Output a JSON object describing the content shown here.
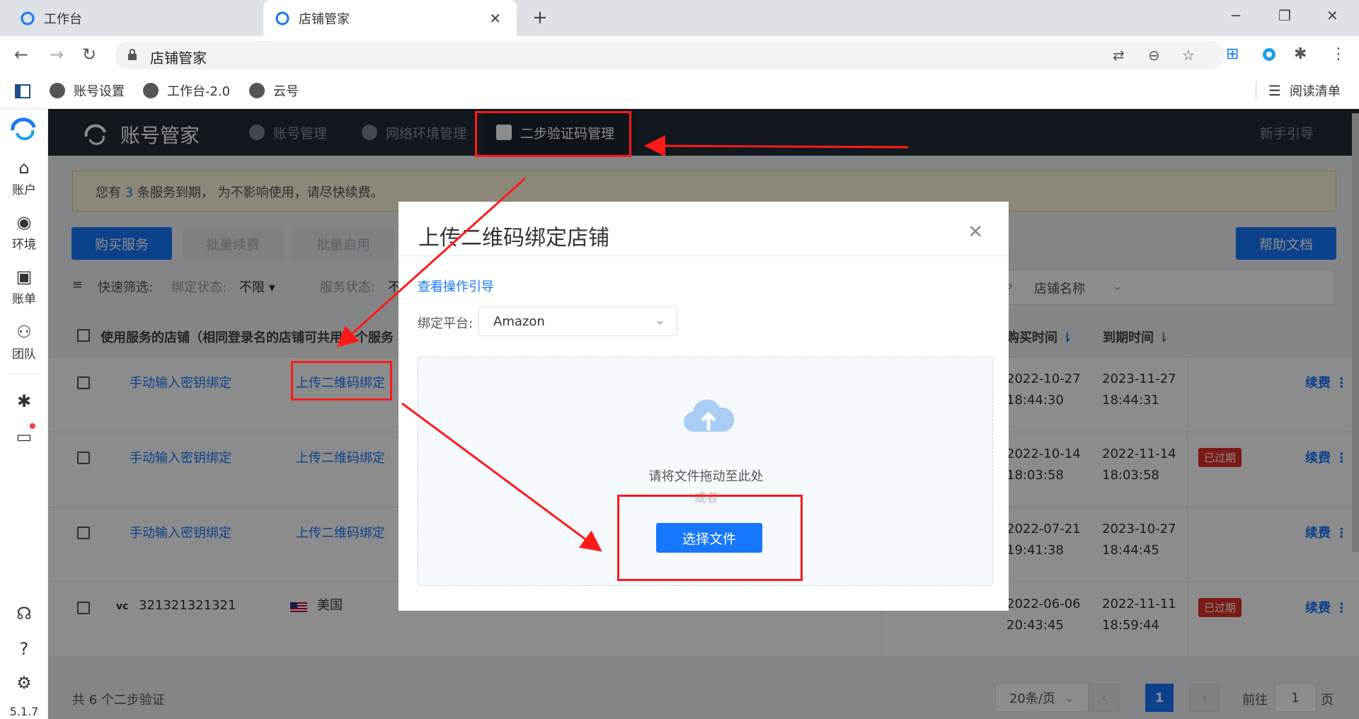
{
  "browser": {
    "tabs": [
      {
        "title": "工作台"
      },
      {
        "title": "店铺管家"
      }
    ],
    "address": "店铺管家",
    "bookmarks": [
      "账号设置",
      "工作台-2.0",
      "云号"
    ],
    "reading_list": "阅读清单"
  },
  "sidebar": {
    "items": [
      {
        "label": "账户",
        "icon": "shop-icon"
      },
      {
        "label": "环境",
        "icon": "globe-icon"
      },
      {
        "label": "账单",
        "icon": "wallet-icon"
      },
      {
        "label": "团队",
        "icon": "team-icon"
      }
    ],
    "version": "5.1.7"
  },
  "app": {
    "title": "账号管家",
    "nav": [
      "账号管理",
      "网络环境管理",
      "二步验证码管理"
    ],
    "guide": "新手引导"
  },
  "notice": {
    "before": "您有",
    "count": "3",
    "after": "条服务到期， 为不影响使用，请尽快续费。"
  },
  "toolbar": {
    "buy": "购买服务",
    "batch_renew": "批量续费",
    "batch_enable": "批量启用",
    "help": "帮助文档"
  },
  "filter": {
    "label": "快速筛选:",
    "bind_label": "绑定状态:",
    "bind_value": "不限",
    "service_label": "服务状态:",
    "service_value": "不",
    "search_field": "店铺名称"
  },
  "table": {
    "header_store": "使用服务的店铺（相同登录名的店铺可共用一个服务",
    "header_buy_time": "购买时间",
    "header_expire_time": "到期时间",
    "rows": [
      {
        "manual": "手动输入密钥绑定",
        "upload": "上传二维码绑定",
        "buy_date": "2022-10-27",
        "buy_time": "18:44:30",
        "exp_date": "2023-11-27",
        "exp_time": "18:44:31",
        "expired": "",
        "renew": "续费"
      },
      {
        "manual": "手动输入密钥绑定",
        "upload": "上传二维码绑定",
        "buy_date": "2022-10-14",
        "buy_time": "18:03:58",
        "exp_date": "2022-11-14",
        "exp_time": "18:03:58",
        "expired": "已过期",
        "renew": "续费"
      },
      {
        "manual": "手动输入密钥绑定",
        "upload": "上传二维码绑定",
        "buy_date": "2022-07-21",
        "buy_time": "19:41:38",
        "exp_date": "2023-10-27",
        "exp_time": "18:44:45",
        "expired": "",
        "renew": "续费"
      },
      {
        "store": "321321321321",
        "country": "美国",
        "buy_date": "2022-06-06",
        "buy_time": "20:43:45",
        "exp_date": "2022-11-11",
        "exp_time": "18:59:44",
        "expired": "已过期",
        "renew": "续费"
      }
    ]
  },
  "footer": {
    "total": "共 6 个二步验证",
    "page_size": "20条/页",
    "current_page": "1",
    "goto_label": "前往",
    "goto_value": "1",
    "page_unit": "页"
  },
  "modal": {
    "title": "上传二维码绑定店铺",
    "guide_link": "查看操作引导",
    "platform_label": "绑定平台:",
    "platform_value": "Amazon",
    "drop_hint": "请将文件拖动至此处",
    "or": "或者",
    "select_button": "选择文件"
  },
  "colors": {
    "accent": "#1677ff",
    "nav_bg": "#242c3a",
    "annotation": "#ff1a1a",
    "expired_tag": "#e0302b"
  }
}
